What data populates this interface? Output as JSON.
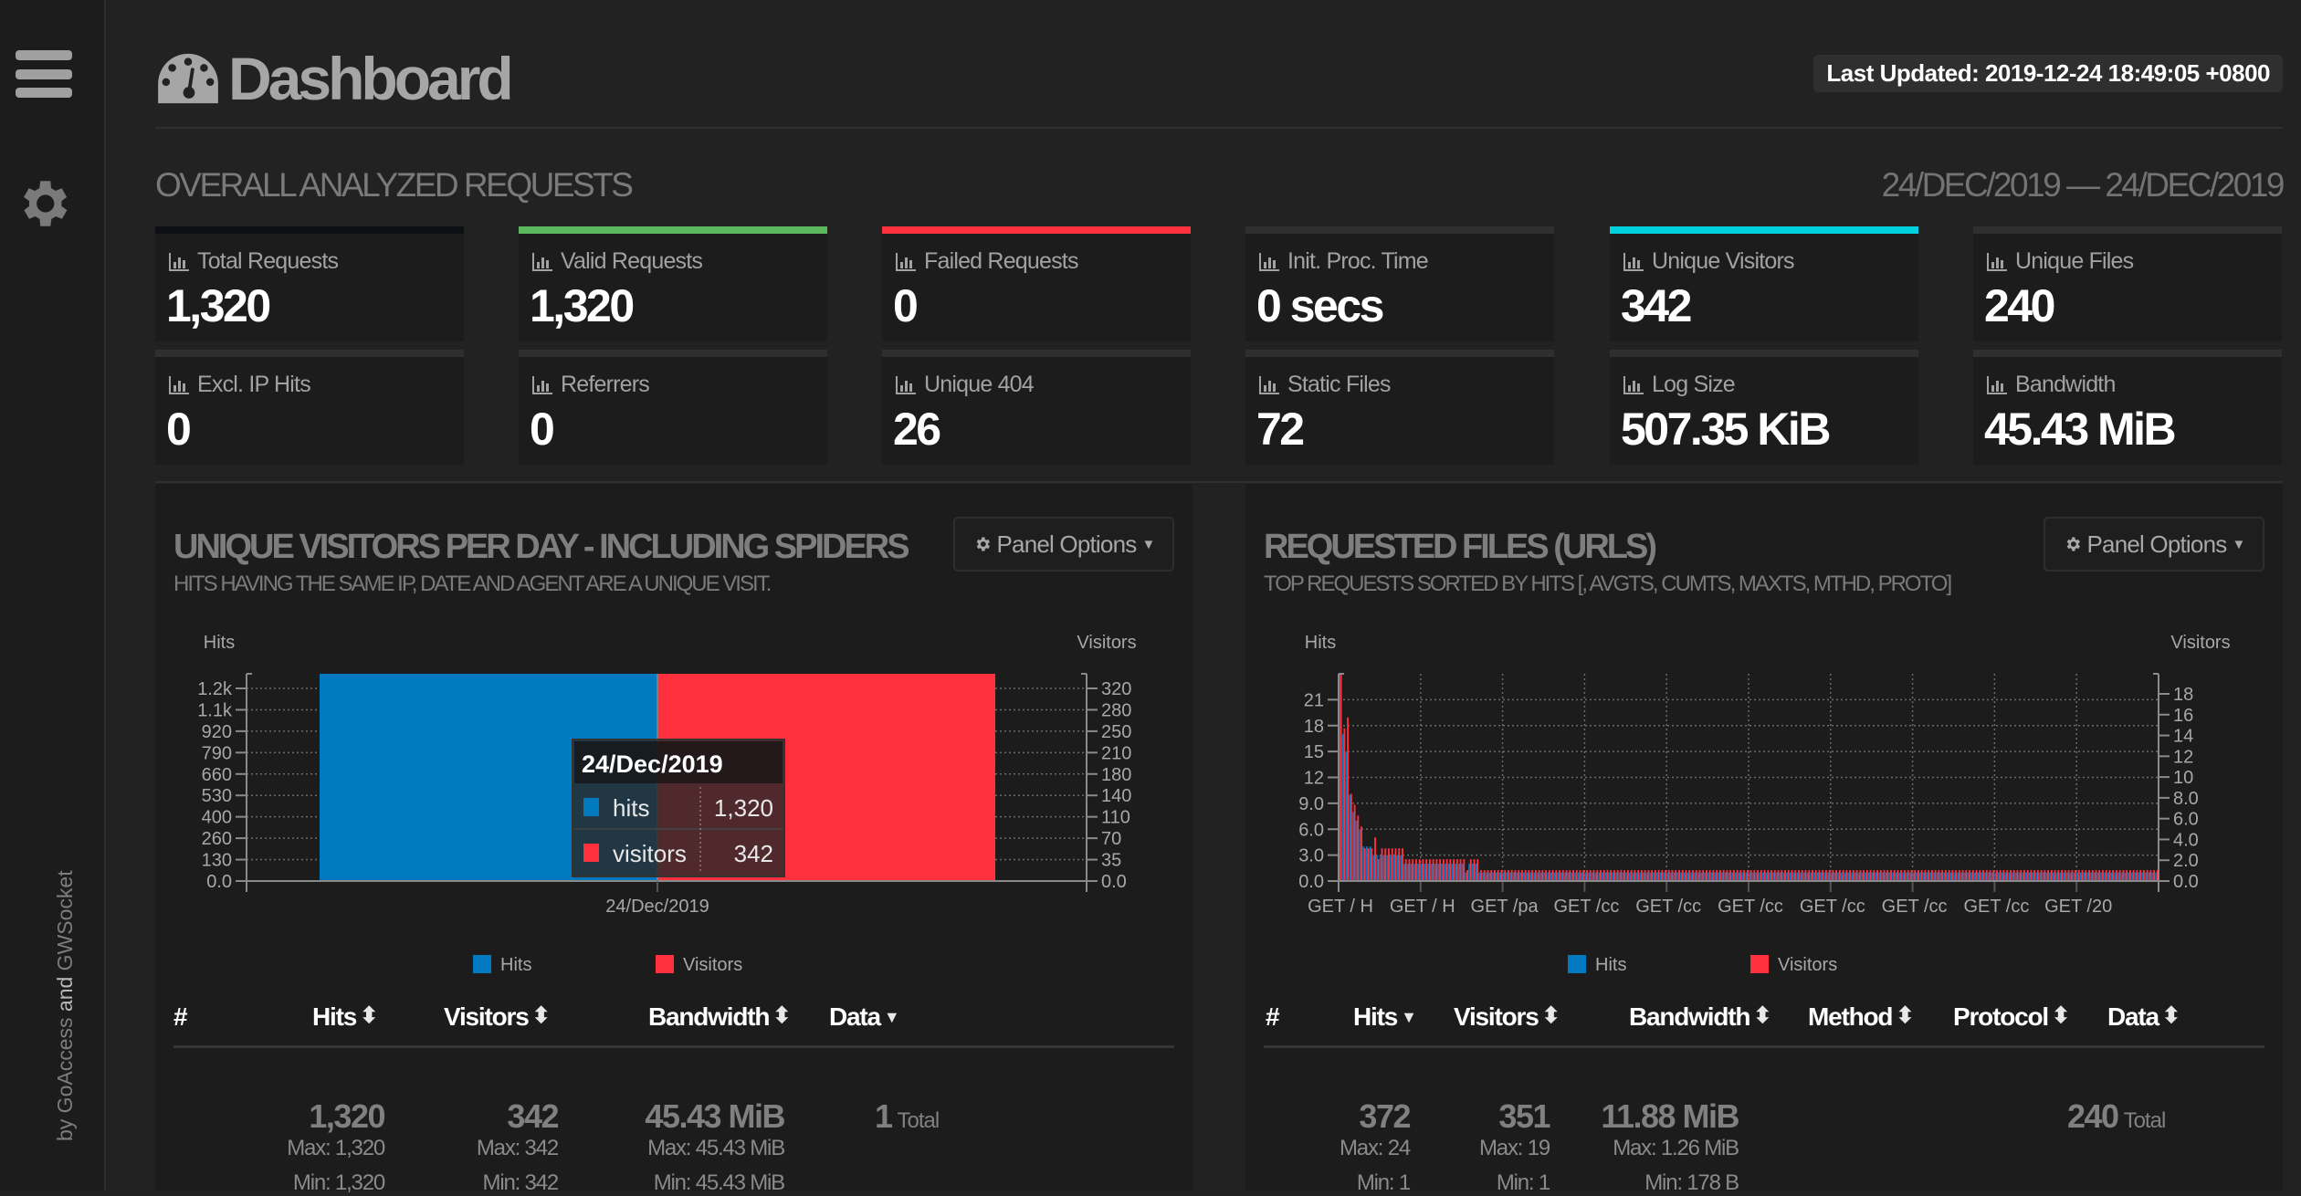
{
  "sidebar": {
    "menu_icon": "hamburger-menu-icon",
    "settings_icon": "gear-icon",
    "credit": {
      "by": "by ",
      "goaccess": "GoAccess",
      "and": " and ",
      "gwsocket": "GWSocket"
    }
  },
  "header": {
    "title_icon": "dashboard-gauge-icon",
    "title": "Dashboard",
    "last_updated": "Last Updated: 2019-12-24 18:49:05 +0800"
  },
  "overall": {
    "title": "OVERALL ANALYZED REQUESTS",
    "date_range": "24/DEC/2019 — 24/DEC/2019",
    "cards": [
      {
        "label": "Total Requests",
        "value": "1,320",
        "accent": "#0d1014"
      },
      {
        "label": "Valid Requests",
        "value": "1,320",
        "accent": "#5cb85c"
      },
      {
        "label": "Failed Requests",
        "value": "0",
        "accent": "#ff303e"
      },
      {
        "label": "Init. Proc. Time",
        "value": "0 secs",
        "accent": "#2f2f2f"
      },
      {
        "label": "Unique Visitors",
        "value": "342",
        "accent": "#00d1df"
      },
      {
        "label": "Unique Files",
        "value": "240",
        "accent": "#2f2f2f"
      },
      {
        "label": "Excl. IP Hits",
        "value": "0",
        "accent": "#2f2f2f"
      },
      {
        "label": "Referrers",
        "value": "0",
        "accent": "#2f2f2f"
      },
      {
        "label": "Unique 404",
        "value": "26",
        "accent": "#2f2f2f"
      },
      {
        "label": "Static Files",
        "value": "72",
        "accent": "#2f2f2f"
      },
      {
        "label": "Log Size",
        "value": "507.35 KiB",
        "accent": "#2f2f2f"
      },
      {
        "label": "Bandwidth",
        "value": "45.43 MiB",
        "accent": "#2f2f2f"
      }
    ]
  },
  "colors": {
    "hits": "#0079c1",
    "visitors": "#ff303e"
  },
  "visitors_panel": {
    "title": "UNIQUE VISITORS PER DAY - INCLUDING SPIDERS",
    "subtitle": "HITS HAVING THE SAME IP, DATE AND AGENT ARE A UNIQUE VISIT.",
    "options_label": "Panel Options",
    "tooltip": {
      "title": "24/Dec/2019",
      "rows": [
        {
          "name": "hits",
          "value": "1,320"
        },
        {
          "name": "visitors",
          "value": "342"
        }
      ]
    },
    "table": {
      "headers": [
        {
          "label": "#",
          "sort": ""
        },
        {
          "label": "Hits",
          "sort": "both"
        },
        {
          "label": "Visitors",
          "sort": "both"
        },
        {
          "label": "Bandwidth",
          "sort": "both"
        },
        {
          "label": "Data",
          "sort": "desc"
        }
      ],
      "summary": {
        "hits": "1,320",
        "hits_max": "Max: 1,320",
        "hits_min": "Min: 1,320",
        "visitors": "342",
        "visitors_max": "Max: 342",
        "visitors_min": "Min: 342",
        "bandwidth": "45.43 MiB",
        "bandwidth_max": "Max: 45.43 MiB",
        "bandwidth_min": "Min: 45.43 MiB",
        "data_count": "1",
        "data_total": "Total"
      }
    }
  },
  "files_panel": {
    "title": "REQUESTED FILES (URLS)",
    "subtitle": "TOP REQUESTS SORTED BY HITS [, AVGTS, CUMTS, MAXTS, MTHD, PROTO]",
    "options_label": "Panel Options",
    "table": {
      "headers": [
        {
          "label": "#",
          "sort": ""
        },
        {
          "label": "Hits",
          "sort": "desc"
        },
        {
          "label": "Visitors",
          "sort": "both"
        },
        {
          "label": "Bandwidth",
          "sort": "both"
        },
        {
          "label": "Method",
          "sort": "both"
        },
        {
          "label": "Protocol",
          "sort": "both"
        },
        {
          "label": "Data",
          "sort": "both"
        }
      ],
      "summary": {
        "hits": "372",
        "hits_max": "Max: 24",
        "hits_min": "Min: 1",
        "visitors": "351",
        "visitors_max": "Max: 19",
        "visitors_min": "Min: 1",
        "bandwidth": "11.88 MiB",
        "bandwidth_max": "Max: 1.26 MiB",
        "bandwidth_min": "Min: 178 B",
        "data_count": "240",
        "data_total": "Total"
      }
    }
  },
  "chart_data": [
    {
      "type": "bar",
      "title": "UNIQUE VISITORS PER DAY - INCLUDING SPIDERS",
      "categories": [
        "24/Dec/2019"
      ],
      "series": [
        {
          "name": "Hits",
          "values": [
            1320
          ],
          "axis": "left"
        },
        {
          "name": "Visitors",
          "values": [
            342
          ],
          "axis": "right"
        }
      ],
      "ylabel_left": "Hits",
      "ylabel_right": "Visitors",
      "yticks_left": [
        "0.0",
        "130",
        "260",
        "400",
        "530",
        "660",
        "790",
        "920",
        "1.1k",
        "1.2k"
      ],
      "ylim_left": [
        0,
        1320
      ],
      "yticks_right": [
        "0.0",
        "35",
        "70",
        "110",
        "140",
        "180",
        "210",
        "250",
        "280",
        "320"
      ],
      "ylim_right": [
        0,
        342
      ],
      "legend": [
        "Hits",
        "Visitors"
      ],
      "legend_position": "bottom",
      "grid": true
    },
    {
      "type": "bar",
      "title": "REQUESTED FILES (URLS)",
      "ylabel_left": "Hits",
      "ylabel_right": "Visitors",
      "yticks_left": [
        "0.0",
        "3.0",
        "6.0",
        "9.0",
        "12",
        "15",
        "18",
        "21"
      ],
      "ylim_left": [
        0,
        24
      ],
      "yticks_right": [
        "0.0",
        "2.0",
        "4.0",
        "6.0",
        "8.0",
        "10",
        "12",
        "14",
        "16",
        "18"
      ],
      "ylim_right": [
        0,
        19
      ],
      "xtick_labels": [
        "GET / H",
        "GET / H",
        "GET /pa",
        "GET /cc",
        "GET /cc",
        "GET /cc",
        "GET /cc",
        "GET /cc",
        "GET /cc",
        "GET /20"
      ],
      "category_count": 240,
      "series": [
        {
          "name": "Hits",
          "axis": "left",
          "values_head": [
            24,
            17,
            15,
            10,
            8,
            7,
            6,
            4,
            4,
            4,
            3,
            3,
            3,
            3,
            3,
            3,
            3,
            3,
            3,
            2,
            2,
            2,
            2,
            2,
            2,
            2,
            2,
            2,
            2,
            2,
            2,
            2,
            2,
            2,
            2,
            2,
            2,
            1,
            2,
            2,
            2
          ],
          "tail_value": 1
        },
        {
          "name": "Visitors",
          "axis": "right",
          "values_head": [
            19,
            14,
            15,
            8,
            7,
            6,
            5,
            3,
            3,
            3,
            4,
            2,
            3,
            3,
            3,
            3,
            3,
            3,
            3,
            2,
            2,
            2,
            2,
            2,
            2,
            2,
            2,
            2,
            2,
            2,
            2,
            2,
            2,
            2,
            2,
            2,
            2,
            1,
            2,
            2,
            2
          ],
          "tail_value": 1
        }
      ],
      "legend": [
        "Hits",
        "Visitors"
      ],
      "legend_position": "bottom",
      "grid": true
    }
  ]
}
